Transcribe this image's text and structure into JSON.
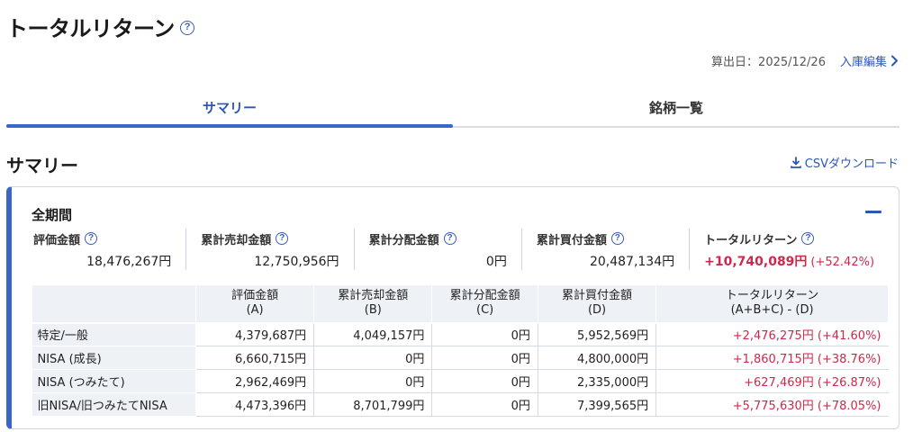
{
  "page": {
    "title": "トータルリターン",
    "help": "?"
  },
  "header": {
    "calc_date": "算出日：2025/12/26",
    "edit_link": "入庫編集"
  },
  "tabs": [
    {
      "label": "サマリー",
      "active": true
    },
    {
      "label": "銘柄一覧",
      "active": false
    }
  ],
  "section": {
    "title": "サマリー",
    "csv_link": "CSVダウンロード"
  },
  "card": {
    "title": "全期間",
    "summary": [
      {
        "label": "評価金額",
        "value": "18,476,267円"
      },
      {
        "label": "累計売却金額",
        "value": "12,750,956円"
      },
      {
        "label": "累計分配金額",
        "value": "0円"
      },
      {
        "label": "累計買付金額",
        "value": "20,487,134円"
      },
      {
        "label": "トータルリターン",
        "value": "+10,740,089円",
        "pct": "(+52.42%)"
      }
    ],
    "table": {
      "headers": [
        {
          "line1": "",
          "line2": ""
        },
        {
          "line1": "評価金額",
          "line2": "(A)"
        },
        {
          "line1": "累計売却金額",
          "line2": "(B)"
        },
        {
          "line1": "累計分配金額",
          "line2": "(C)"
        },
        {
          "line1": "累計買付金額",
          "line2": "(D)"
        },
        {
          "line1": "トータルリターン",
          "line2": "(A+B+C) - (D)"
        }
      ],
      "rows": [
        {
          "name": "特定/一般",
          "a": "4,379,687円",
          "b": "4,049,157円",
          "c": "0円",
          "d": "5,952,569円",
          "r": "+2,476,275円 (+41.60%)"
        },
        {
          "name": "NISA (成長)",
          "a": "6,660,715円",
          "b": "0円",
          "c": "0円",
          "d": "4,800,000円",
          "r": "+1,860,715円 (+38.76%)"
        },
        {
          "name": "NISA (つみたて)",
          "a": "2,962,469円",
          "b": "0円",
          "c": "0円",
          "d": "2,335,000円",
          "r": "+627,469円 (+26.87%)"
        },
        {
          "name": "旧NISA/旧つみたてNISA",
          "a": "4,473,396円",
          "b": "8,701,799円",
          "c": "0円",
          "d": "7,399,565円",
          "r": "+5,775,630円 (+78.05%)"
        }
      ]
    }
  },
  "colors": {
    "accent": "#2d56b8",
    "positive": "#d0284b"
  }
}
